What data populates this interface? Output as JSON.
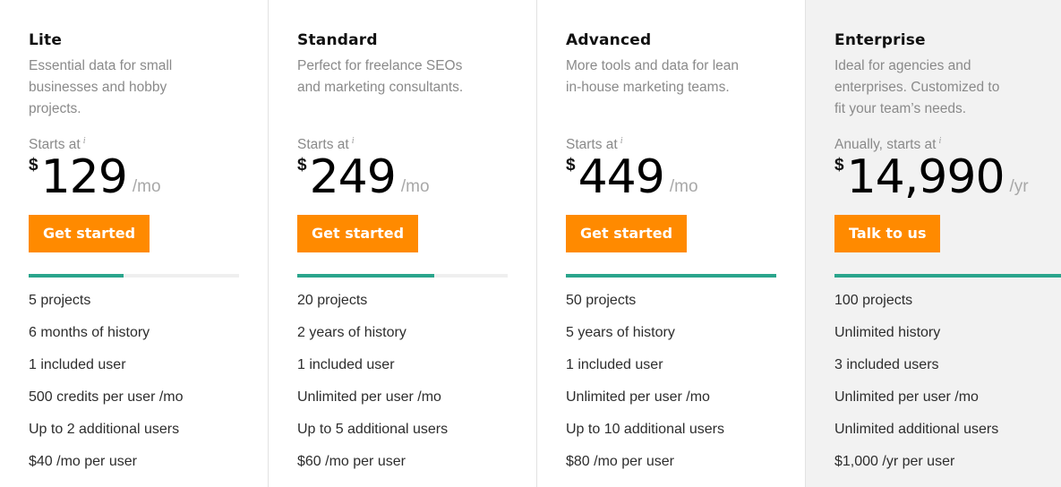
{
  "colors": {
    "accent_orange": "#ff8a00",
    "progress_green": "#2aa58c",
    "highlight_bg": "#f2f2f2"
  },
  "plans": [
    {
      "name": "Lite",
      "description": "Essential data for small businesses and hobby projects.",
      "starts_label": "Starts at",
      "info_icon": "i",
      "currency": "$",
      "price": "129",
      "period": "/mo",
      "cta": "Get started",
      "tier_fill_percent": 45,
      "features": [
        "5 projects",
        "6 months of history",
        "1 included user",
        "500 credits per user /mo",
        "Up to 2 additional users",
        "$40 /mo per user"
      ]
    },
    {
      "name": "Standard",
      "description": "Perfect for freelance SEOs and marketing consultants.",
      "starts_label": "Starts at",
      "info_icon": "i",
      "currency": "$",
      "price": "249",
      "period": "/mo",
      "cta": "Get started",
      "tier_fill_percent": 65,
      "features": [
        "20 projects",
        "2 years of history",
        "1 included user",
        "Unlimited per user /mo",
        "Up to 5 additional users",
        "$60 /mo per user"
      ]
    },
    {
      "name": "Advanced",
      "description": "More tools and data for lean in-house marketing teams.",
      "starts_label": "Starts at",
      "info_icon": "i",
      "currency": "$",
      "price": "449",
      "period": "/mo",
      "cta": "Get started",
      "tier_fill_percent": 100,
      "features": [
        "50 projects",
        "5 years of history",
        "1 included user",
        "Unlimited per user /mo",
        "Up to 10 additional users",
        "$80 /mo per user"
      ]
    },
    {
      "name": "Enterprise",
      "description": "Ideal for agencies and enterprises. Customized to fit your team’s needs.",
      "starts_label": "Anually, starts at",
      "info_icon": "i",
      "currency": "$",
      "price": "14,990",
      "period": "/yr",
      "cta": "Talk to us",
      "tier_fill_percent": 100,
      "features": [
        "100 projects",
        "Unlimited history",
        "3 included users",
        "Unlimited per user /mo",
        "Unlimited additional users",
        "$1,000 /yr per user"
      ]
    }
  ]
}
